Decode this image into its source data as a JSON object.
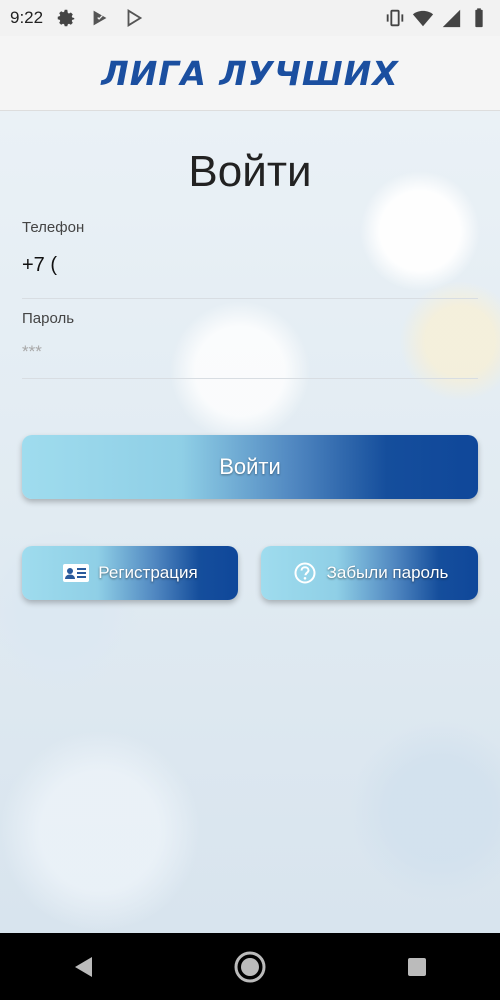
{
  "status_bar": {
    "time": "9:22",
    "left_icons": [
      "settings-icon",
      "play-protect-icon",
      "play-store-icon"
    ],
    "right_icons": [
      "vibrate-icon",
      "wifi-icon",
      "signal-icon",
      "battery-icon"
    ]
  },
  "header": {
    "logo_text": "ЛИГА ЛУЧШИХ",
    "logo_color": "#1b4fa0"
  },
  "login": {
    "title": "Войти",
    "phone_label": "Телефон",
    "phone_value": "+7 (",
    "password_label": "Пароль",
    "password_placeholder": "***",
    "submit_label": "Войти"
  },
  "actions": {
    "register_label": "Регистрация",
    "register_icon": "id-card-icon",
    "forgot_label": "Забыли пароль",
    "forgot_icon": "question-circle-icon"
  },
  "nav_bar": {
    "buttons": [
      "back-icon",
      "home-icon",
      "recents-icon"
    ]
  },
  "colors": {
    "button_gradient_start": "#9fdcee",
    "button_gradient_end": "#0f479a"
  }
}
